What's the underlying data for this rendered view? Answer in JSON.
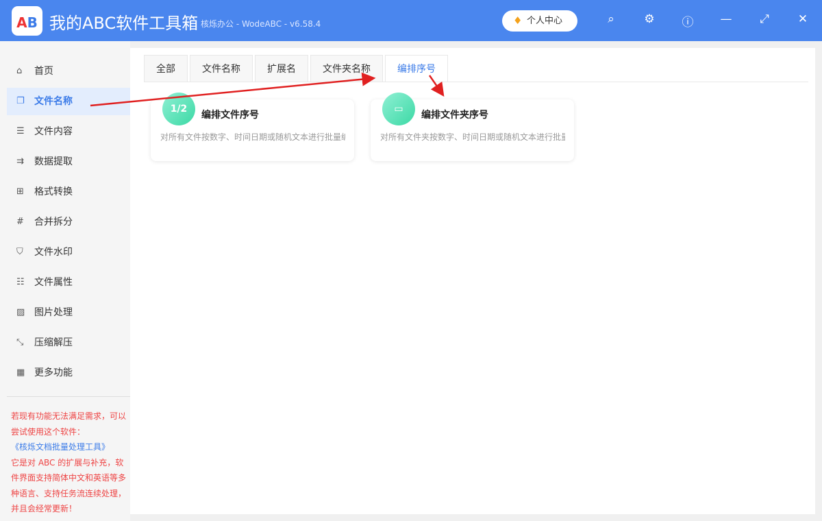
{
  "window": {
    "title": "我的ABC软件工具箱",
    "subtitle": "核烁办公 - WodeABC - v6.58.4",
    "logo_text": "AB",
    "user_center": "个人中心",
    "icons": [
      "search-icon",
      "gear-icon",
      "help-icon",
      "minimize-icon",
      "maximize-icon",
      "close-icon"
    ]
  },
  "sidebar": {
    "items": [
      {
        "label": "首页",
        "icon": "home-icon"
      },
      {
        "label": "文件名称",
        "icon": "file-icon"
      },
      {
        "label": "文件内容",
        "icon": "list-icon"
      },
      {
        "label": "数据提取",
        "icon": "extract-icon"
      },
      {
        "label": "格式转换",
        "icon": "convert-icon"
      },
      {
        "label": "合并拆分",
        "icon": "hash-icon"
      },
      {
        "label": "文件水印",
        "icon": "shield-icon"
      },
      {
        "label": "文件属性",
        "icon": "properties-icon"
      },
      {
        "label": "图片处理",
        "icon": "image-icon"
      },
      {
        "label": "压缩解压",
        "icon": "compress-icon"
      },
      {
        "label": "更多功能",
        "icon": "grid-icon"
      }
    ],
    "promo": {
      "line1": "若现有功能无法满足需求，可以尝试使用这个软件：",
      "link": "《核烁文档批量处理工具》",
      "line2": "它是对 ABC 的扩展与补充，软件界面支持简体中文和英语等多种语言、支持任务流连续处理，并且会经常更新！"
    }
  },
  "tabs": [
    "全部",
    "文件名称",
    "扩展名",
    "文件夹名称",
    "编排序号"
  ],
  "cards": [
    {
      "title": "编排文件序号",
      "desc": "对所有文件按数字、时间日期或随机文本进行批量编排序号",
      "icon_text": "1/2"
    },
    {
      "title": "编排文件夹序号",
      "desc": "对所有文件夹按数字、时间日期或随机文本进行批量编排序号",
      "icon_text": "▭"
    }
  ],
  "colors": {
    "accent": "#3b7be8",
    "titlebar": "#4a86ee",
    "annotation": "#e02020"
  }
}
